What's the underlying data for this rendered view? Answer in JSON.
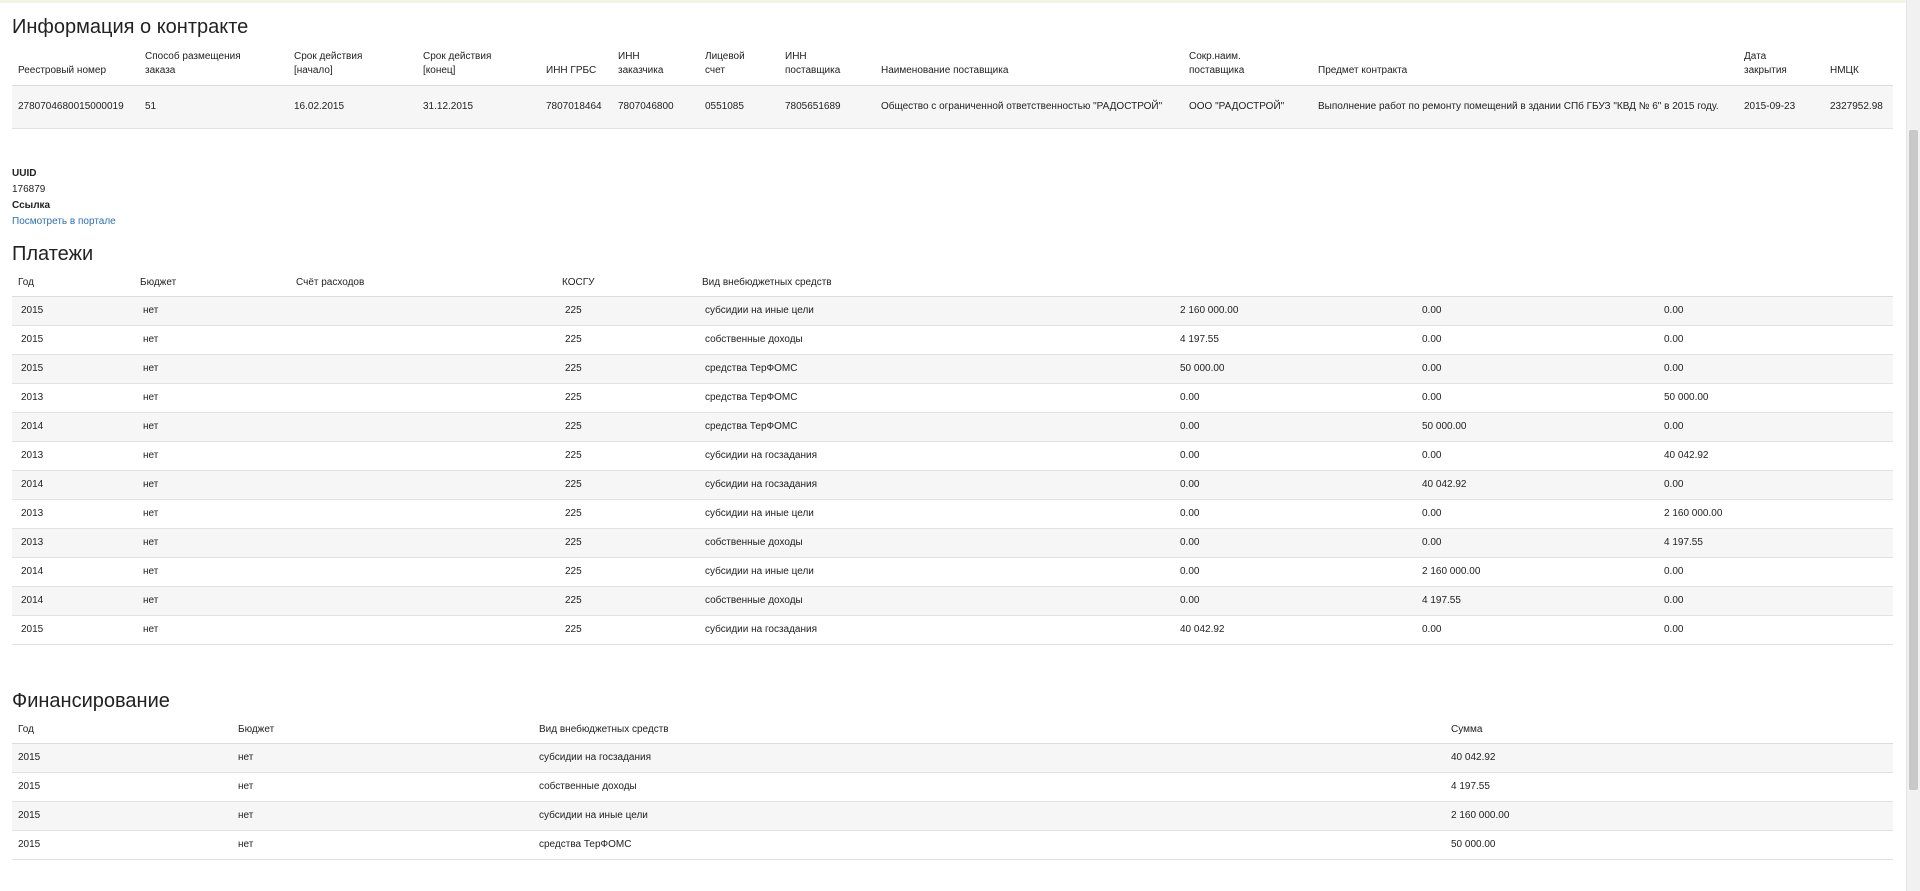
{
  "contract": {
    "title": "Информация о контракте",
    "headers": [
      [
        "Реестровый номер"
      ],
      [
        "Способ размещения",
        "заказа"
      ],
      [
        "Срок действия",
        "[начало]"
      ],
      [
        "Срок действия",
        "[конец]"
      ],
      [
        "ИНН ГРБС"
      ],
      [
        "ИНН",
        "заказчика"
      ],
      [
        "Лицевой",
        "счет"
      ],
      [
        "ИНН",
        "поставщика"
      ],
      [
        "Наименование поставщика"
      ],
      [
        "Сокр.наим.",
        "поставщика"
      ],
      [
        "Предмет контракта"
      ],
      [
        "Дата",
        "закрытия"
      ],
      [
        "НМЦК"
      ]
    ],
    "row": [
      "2780704680015000019",
      "51",
      "16.02.2015",
      "31.12.2015",
      "7807018464",
      "7807046800",
      "0551085",
      "7805651689",
      "Общество с ограниченной ответственностью \"РАДОСТРОЙ\"",
      "ООО \"РАДОСТРОЙ\"",
      "Выполнение работ по ремонту помещений в здании СПб ГБУЗ \"КВД № 6\" в 2015 году.",
      "2015-09-23",
      "2327952.98"
    ]
  },
  "meta": {
    "uuid_label": "UUID",
    "uuid_value": "176879",
    "link_label": "Ссылка",
    "link_text": "Посмотреть в портале"
  },
  "payments": {
    "title": "Платежи",
    "headers": [
      "Год",
      "Бюджет",
      "Счёт расходов",
      "КОСГУ",
      "Вид внебюджетных средств",
      "",
      "",
      ""
    ],
    "rows": [
      [
        "2015",
        "нет",
        "",
        "225",
        "субсидии на иные цели",
        "2 160 000.00",
        "0.00",
        "0.00"
      ],
      [
        "2015",
        "нет",
        "",
        "225",
        "собственные доходы",
        "4 197.55",
        "0.00",
        "0.00"
      ],
      [
        "2015",
        "нет",
        "",
        "225",
        "средства ТерФОМС",
        "50 000.00",
        "0.00",
        "0.00"
      ],
      [
        "2013",
        "нет",
        "",
        "225",
        "средства ТерФОМС",
        "0.00",
        "0.00",
        "50 000.00"
      ],
      [
        "2014",
        "нет",
        "",
        "225",
        "средства ТерФОМС",
        "0.00",
        "50 000.00",
        "0.00"
      ],
      [
        "2013",
        "нет",
        "",
        "225",
        "субсидии на госзадания",
        "0.00",
        "0.00",
        "40 042.92"
      ],
      [
        "2014",
        "нет",
        "",
        "225",
        "субсидии на госзадания",
        "0.00",
        "40 042.92",
        "0.00"
      ],
      [
        "2013",
        "нет",
        "",
        "225",
        "субсидии на иные цели",
        "0.00",
        "0.00",
        "2 160 000.00"
      ],
      [
        "2013",
        "нет",
        "",
        "225",
        "собственные доходы",
        "0.00",
        "0.00",
        "4 197.55"
      ],
      [
        "2014",
        "нет",
        "",
        "225",
        "субсидии на иные цели",
        "0.00",
        "2 160 000.00",
        "0.00"
      ],
      [
        "2014",
        "нет",
        "",
        "225",
        "собственные доходы",
        "0.00",
        "4 197.55",
        "0.00"
      ],
      [
        "2015",
        "нет",
        "",
        "225",
        "субсидии на госзадания",
        "40 042.92",
        "0.00",
        "0.00"
      ]
    ]
  },
  "funding": {
    "title": "Финансирование",
    "headers": [
      "Год",
      "Бюджет",
      "Вид внебюджетных средств",
      "Сумма"
    ],
    "rows": [
      [
        "2015",
        "нет",
        "субсидии на госзадания",
        "40 042.92"
      ],
      [
        "2015",
        "нет",
        "собственные доходы",
        "4 197.55"
      ],
      [
        "2015",
        "нет",
        "субсидии на иные цели",
        "2 160 000.00"
      ],
      [
        "2015",
        "нет",
        "средства ТерФОМС",
        "50 000.00"
      ]
    ]
  }
}
